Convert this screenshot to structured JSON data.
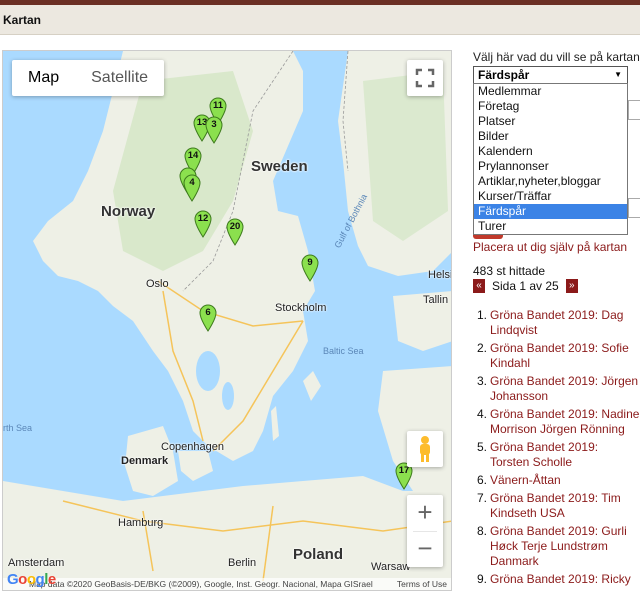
{
  "header": {
    "title": "Kartan"
  },
  "map": {
    "type_buttons": {
      "map": "Map",
      "satellite": "Satellite"
    },
    "labels": {
      "norway": "Norway",
      "sweden": "Sweden",
      "poland": "Poland",
      "oslo": "Oslo",
      "stockholm": "Stockholm",
      "helsinki": "Helsi",
      "tallinn": "Tallin",
      "copenhagen": "Copenhagen",
      "denmark": "Denmark",
      "hamburg": "Hamburg",
      "amsterdam": "Amsterdam",
      "berlin": "Berlin",
      "warsaw": "Warsaw",
      "baltic_sea": "Baltic Sea",
      "gulf_of_bothnia": "Gulf of Bothnia",
      "north_sea": "rth Sea"
    },
    "markers": [
      "11",
      "13",
      "3",
      "14",
      "4",
      "12",
      "20",
      "9",
      "6",
      "17"
    ],
    "attribution": "Map data ©2020 GeoBasis-DE/BKG (©2009), Google, Inst. Geogr. Nacional, Mapa GISrael",
    "terms": "Terms of Use",
    "google_logo": "Google",
    "zoom_in": "+",
    "zoom_out": "−"
  },
  "panel": {
    "choose_label": "Välj här vad du vill se på kartan:",
    "selected": "Färdspår",
    "options": [
      "Medlemmar",
      "Företag",
      "Platser",
      "Bilder",
      "Kalendern",
      "Prylannonser",
      "Artiklar,nyheter,bloggar",
      "Kurser/Träffar",
      "Färdspår",
      "Turer"
    ],
    "place_link": "Placera ut dig själv på kartan",
    "found": "483 st hittade",
    "pager": {
      "prev": "«",
      "text": "Sida 1 av 25",
      "next": "»"
    },
    "results": [
      {
        "num": "1.",
        "title": "Gröna Bandet 2019: Dag Lindqvist"
      },
      {
        "num": "2.",
        "title": "Gröna Bandet 2019: Sofie Kindahl"
      },
      {
        "num": "3.",
        "title": "Gröna Bandet 2019: Jörgen Johansson"
      },
      {
        "num": "4.",
        "title": "Gröna Bandet 2019: Nadine Morrison Jörgen Rönning"
      },
      {
        "num": "5.",
        "title": "Gröna Bandet 2019: Torsten Scholle"
      },
      {
        "num": "6.",
        "title": "Vänern-Åttan"
      },
      {
        "num": "7.",
        "title": "Gröna Bandet 2019: Tim Kindseth USA"
      },
      {
        "num": "8.",
        "title": "Gröna Bandet 2019: Gurli Høck Terje Lundstrøm Danmark"
      },
      {
        "num": "9.",
        "title": "Gröna Bandet 2019: Ricky"
      }
    ]
  },
  "colors": {
    "accent": "#8b1a1a",
    "marker": "#8be04e",
    "selected_option": "#3b83e6"
  }
}
